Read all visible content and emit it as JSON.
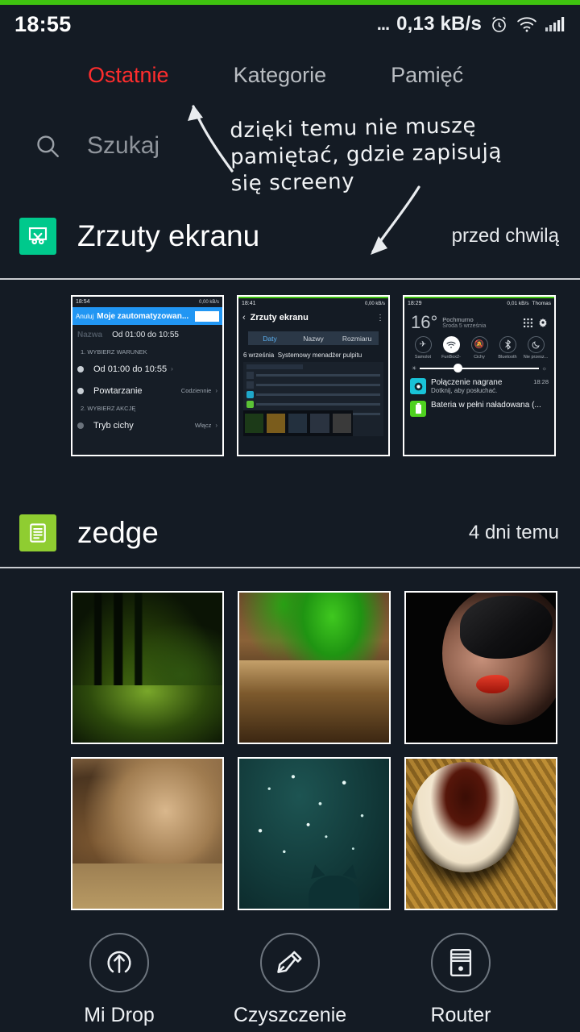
{
  "statusbar": {
    "time": "18:55",
    "dots": "...",
    "network_speed": "0,13 kB/s",
    "icons": [
      "alarm-icon",
      "wifi-icon",
      "signal-icon"
    ]
  },
  "tabs": [
    {
      "label": "Ostatnie",
      "active": true
    },
    {
      "label": "Kategorie",
      "active": false
    },
    {
      "label": "Pamięć",
      "active": false
    }
  ],
  "search": {
    "placeholder": "Szukaj",
    "icon": "search-icon"
  },
  "annotation": {
    "line1": "dzięki temu nie muszę",
    "line2": "pamiętać, gdzie zapisują",
    "line3": "się screeny"
  },
  "sections": [
    {
      "icon": "screenshot-scissors-icon",
      "icon_color": "#00c98c",
      "title": "Zrzuty ekranu",
      "time": "przed chwilą"
    },
    {
      "icon": "document-lines-icon",
      "icon_color": "#8fcd31",
      "title": "zedge",
      "time": "4 dni temu"
    }
  ],
  "screenshot_thumbs": [
    {
      "name": "automation-task-screenshot",
      "status_time": "18:54",
      "status_speed": "0,00 kB/s",
      "cancel": "Anuluj",
      "title": "Moje zautomatyzowan...",
      "field_label": "Nazwa",
      "field_value": "Od 01:00 do 10:55",
      "section1": "1. WYBIERZ WARUNEK",
      "row1": "Od 01:00 do 10:55",
      "row2": "Powtarzanie",
      "row2_value": "Codziennie",
      "section2": "2. WYBIERZ AKCJĘ",
      "row3": "Tryb cichy",
      "row3_value": "Włącz"
    },
    {
      "name": "screenshots-folder-screenshot",
      "status_time": "18:41",
      "status_speed": "0,00 kB/s",
      "title": "Zrzuty ekranu",
      "sort_tabs": [
        "Daty",
        "Nazwy",
        "Rozmiaru"
      ],
      "sort_active": "Daty",
      "date": "6 września",
      "source": "Systemowy menadżer pulpitu"
    },
    {
      "name": "notification-shade-screenshot",
      "status_time": "18:29",
      "status_speed": "0,01 kB/s",
      "carrier": "Thomas",
      "temperature": "16°",
      "weather": "Pochmurno",
      "date": "Środa 5 września",
      "toggles": [
        "Samolot",
        "FunBox2-",
        "Cichy",
        "Bluetooth",
        "Nie przesz..."
      ],
      "toggle_active": "FunBox2-",
      "notif1_title": "Połączenie nagrane",
      "notif1_sub": "Dotknij, aby posłuchać.",
      "notif1_time": "18:28",
      "notif2_title": "Bateria w pełni naładowana (..."
    }
  ],
  "photos": [
    {
      "name": "night-forest-wallpaper"
    },
    {
      "name": "mushroom-leaf-wallpaper"
    },
    {
      "name": "masked-woman-wallpaper"
    },
    {
      "name": "lion-wallpaper"
    },
    {
      "name": "cat-stars-wallpaper"
    },
    {
      "name": "coffee-cup-wallpaper"
    }
  ],
  "bottom_toolbar": [
    {
      "label": "Mi Drop",
      "icon": "upload-circle-icon"
    },
    {
      "label": "Czyszczenie",
      "icon": "brush-icon"
    },
    {
      "label": "Router",
      "icon": "router-icon"
    }
  ],
  "colors": {
    "background": "#141b24",
    "accent_red": "#ff2d2d",
    "top_edge_green": "#3fc310",
    "screenshot_icon_teal": "#00c98c",
    "zedge_icon_lime": "#8fcd31"
  }
}
